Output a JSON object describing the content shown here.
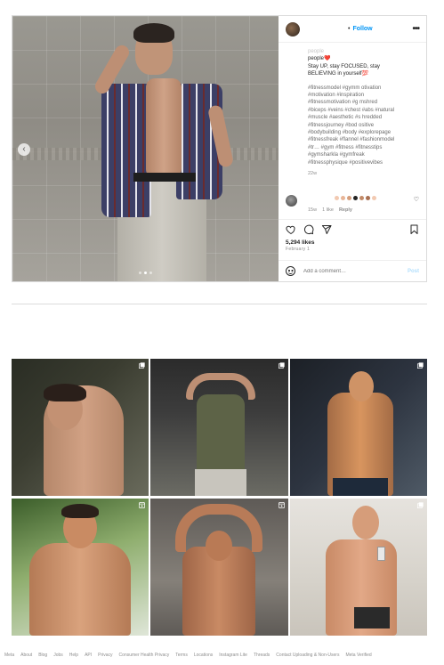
{
  "post": {
    "carousel": {
      "slide_count": 3,
      "active_slide": 2
    },
    "header": {
      "follow_label": "Follow",
      "dot": "•",
      "more": "•••"
    },
    "caption": {
      "faded_line": "people",
      "lines": [
        "people❤️",
        "Stay UP, stay FOCUSED, stay",
        "BELIEVING in yourself💯"
      ],
      "hashtags": [
        "#fitnessmodel #gymm otivation",
        "#motivation #inspiration",
        "#fitnessmotivation #g mshred",
        "#biceps #veins #chest #abs #natural",
        "#muscle #aesthetic #s hredded",
        "#fitnessjourney #bod ositive",
        "#bodybuilding #body #explorepage",
        "#fitnessfreak #flannel #fashionmodel",
        "#tr… #gym #fitness #fitnesstips",
        "#gymsharkla #gymfreak",
        "#fitnessphysique #positivevibes"
      ],
      "age": "22w"
    },
    "comment": {
      "emoji_colors": [
        "#f2c9b1",
        "#e8b597",
        "#d59e7c",
        "#222222",
        "#c28a68",
        "#a86f52",
        "#f2c9b1"
      ],
      "time": "15w",
      "likes": "1 like",
      "reply": "Reply"
    },
    "likes": "5,294 likes",
    "date": "February 1",
    "add_comment": {
      "placeholder": "Add a comment…",
      "post_label": "Post"
    }
  },
  "grid": [
    {
      "badge": "carousel-icon"
    },
    {
      "badge": "carousel-icon"
    },
    {
      "badge": "carousel-icon"
    },
    {
      "badge": "reels-icon"
    },
    {
      "badge": "reels-icon"
    },
    {
      "badge": "carousel-icon"
    }
  ],
  "footer": [
    "Meta",
    "About",
    "Blog",
    "Jobs",
    "Help",
    "API",
    "Privacy",
    "Consumer Health Privacy",
    "Terms",
    "Locations",
    "Instagram Lite",
    "Threads",
    "Contact Uploading & Non-Users",
    "Meta Verified"
  ],
  "colors": {
    "accent": "#0095f6",
    "border": "#dbdbdb",
    "muted": "#8e8e8e",
    "post_disabled": "#b2dffc"
  }
}
